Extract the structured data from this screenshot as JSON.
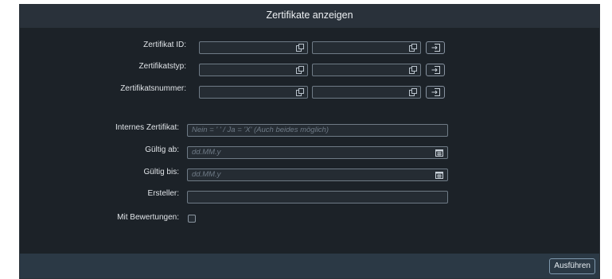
{
  "dialog": {
    "title": "Zertifikate anzeigen"
  },
  "range_fields": [
    {
      "label": "Zertifikat ID:",
      "from_value": "",
      "to_value": "",
      "from_icon": "value-help-icon",
      "to_icon": "value-help-icon",
      "select_icon": "multiple-selection-icon"
    },
    {
      "label": "Zertifikatstyp:",
      "from_value": "",
      "to_value": "",
      "from_icon": "value-help-icon",
      "to_icon": "value-help-icon",
      "select_icon": "multiple-selection-icon"
    },
    {
      "label": "Zertifikatsnummer:",
      "from_value": "",
      "to_value": "",
      "from_icon": "value-help-icon",
      "to_icon": "value-help-icon",
      "select_icon": "multiple-selection-icon"
    }
  ],
  "fields": {
    "internal": {
      "label": "Internes Zertifikat:",
      "value": "",
      "placeholder": "Nein = '  ' / Ja = 'X' (Auch beides möglich)"
    },
    "valid_from": {
      "label": "Gültig ab:",
      "value": "",
      "placeholder": "dd.MM.y",
      "icon": "calendar-icon"
    },
    "valid_to": {
      "label": "Gültig bis:",
      "value": "",
      "placeholder": "dd.MM.y",
      "icon": "calendar-icon"
    },
    "creator": {
      "label": "Ersteller:",
      "value": "",
      "placeholder": ""
    },
    "with_ratings": {
      "label": "Mit Bewertungen:",
      "checked": false
    }
  },
  "footer": {
    "execute_label": "Ausführen"
  },
  "colors": {
    "background": "#1c2228",
    "header": "#29313a",
    "footer": "#2b3945",
    "field_border": "#6f7b86"
  }
}
